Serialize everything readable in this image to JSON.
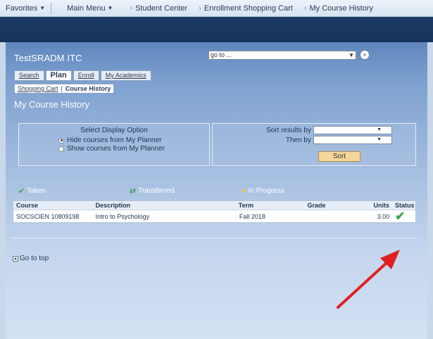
{
  "topnav": {
    "favorites": "Favorites",
    "main_menu": "Main Menu",
    "breadcrumbs": [
      "Student Center",
      "Enrollment Shopping Cart",
      "My Course History"
    ]
  },
  "header": {
    "institution": "TestSRADM ITC",
    "goto_value": "go to ..."
  },
  "tabs": [
    "Search",
    "Plan",
    "Enroll",
    "My Academics"
  ],
  "subtabs": [
    "Shopping Cart",
    "Course History"
  ],
  "page_title": "My Course History",
  "display_option": {
    "heading": "Select Display Option",
    "hide": "Hide courses from My Planner",
    "show": "Show courses from My Planner"
  },
  "sort": {
    "label1": "Sort results by",
    "label2": "Then by",
    "button": "Sort"
  },
  "legend": {
    "taken": "Taken",
    "transferred": "Transferred",
    "in_progress": "In Progress"
  },
  "table": {
    "headers": [
      "Course",
      "Description",
      "Term",
      "Grade",
      "Units",
      "Status"
    ],
    "rows": [
      {
        "course": "SOCSCIEN 10809198",
        "description": "Intro to Psychology",
        "term": "Fall 2018",
        "grade": "",
        "units": "3.00"
      }
    ]
  },
  "go_to_top": "Go to top",
  "colors": {
    "banner": "#17345c",
    "taken_check": "#3aa64a",
    "transferred": "#2f9e3f",
    "in_progress": "#f2c53d",
    "annotation_arrow": "#e02020"
  },
  "icons": {
    "status": "check-icon",
    "annotation": "red-arrow"
  }
}
